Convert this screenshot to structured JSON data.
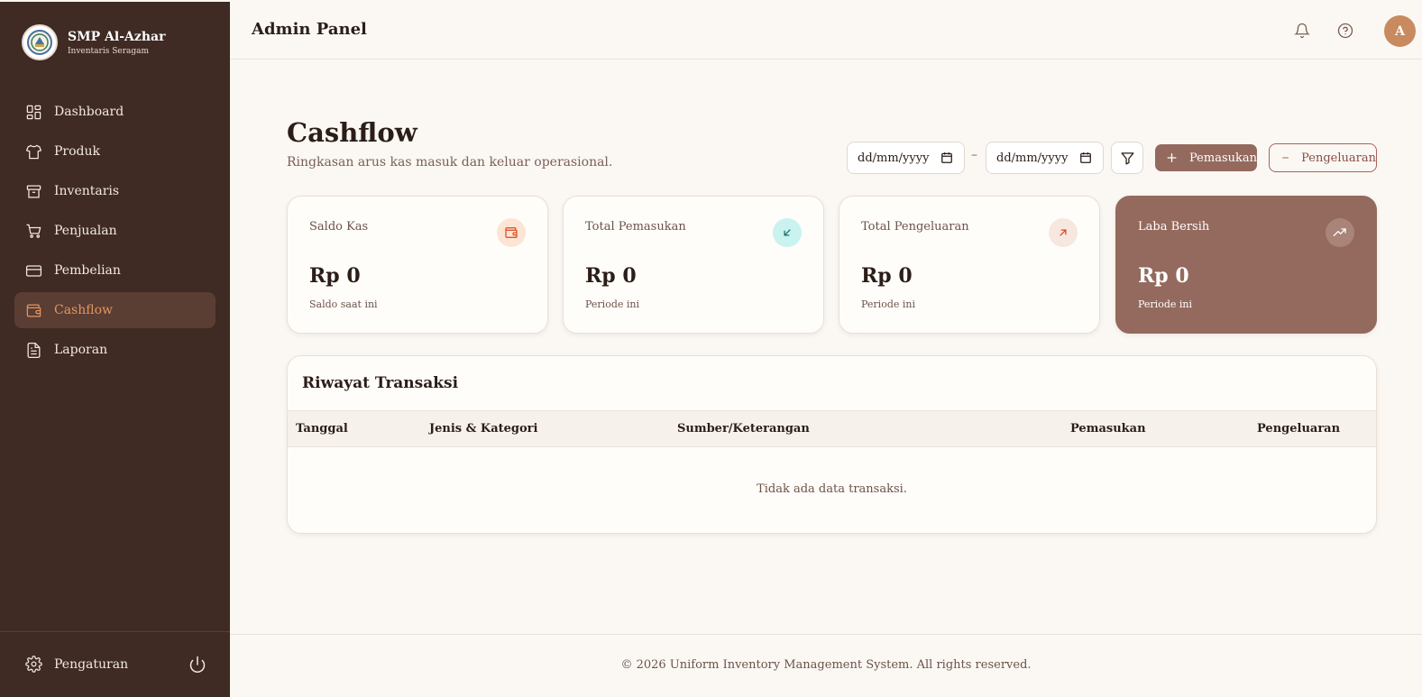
{
  "brand": {
    "name": "SMP Al-Azhar",
    "subtitle": "Inventaris Seragam"
  },
  "sidebar": {
    "items": [
      {
        "label": "Dashboard",
        "icon": "dashboard-grid-icon",
        "active": false
      },
      {
        "label": "Produk",
        "icon": "shirt-icon",
        "active": false
      },
      {
        "label": "Inventaris",
        "icon": "archive-box-icon",
        "active": false
      },
      {
        "label": "Penjualan",
        "icon": "cart-icon",
        "active": false
      },
      {
        "label": "Pembelian",
        "icon": "credit-card-icon",
        "active": false
      },
      {
        "label": "Cashflow",
        "icon": "wallet-icon",
        "active": true
      },
      {
        "label": "Laporan",
        "icon": "document-icon",
        "active": false
      }
    ],
    "settings_label": "Pengaturan"
  },
  "header": {
    "title": "Admin Panel",
    "avatar_initial": "A"
  },
  "page": {
    "title": "Cashflow",
    "subtitle": "Ringkasan arus kas masuk dan keluar operasional.",
    "date_from_placeholder": "dd/mm/yyyy",
    "date_to_placeholder": "dd/mm/yyyy",
    "date_separator": "–",
    "income_button": "Pemasukan",
    "expense_button": "Pengeluaran"
  },
  "cards": [
    {
      "label": "Saldo Kas",
      "value": "Rp 0",
      "note": "Saldo saat ini",
      "icon": "wallet-icon"
    },
    {
      "label": "Total Pemasukan",
      "value": "Rp 0",
      "note": "Periode ini",
      "icon": "arrow-down-left-icon"
    },
    {
      "label": "Total Pengeluaran",
      "value": "Rp 0",
      "note": "Periode ini",
      "icon": "arrow-up-right-icon"
    },
    {
      "label": "Laba Bersih",
      "value": "Rp 0",
      "note": "Periode ini",
      "icon": "trending-up-icon"
    }
  ],
  "transactions": {
    "title": "Riwayat Transaksi",
    "columns": [
      "Tanggal",
      "Jenis & Kategori",
      "Sumber/Keterangan",
      "Pemasukan",
      "Pengeluaran"
    ],
    "empty_text": "Tidak ada data transaksi."
  },
  "footer": {
    "text": "© 2026 Uniform Inventory Management System. All rights reserved."
  },
  "colors": {
    "sidebar": "#3f2a24",
    "accent": "#936a5d",
    "active_text": "#e39561",
    "background": "#fbf8f4"
  }
}
